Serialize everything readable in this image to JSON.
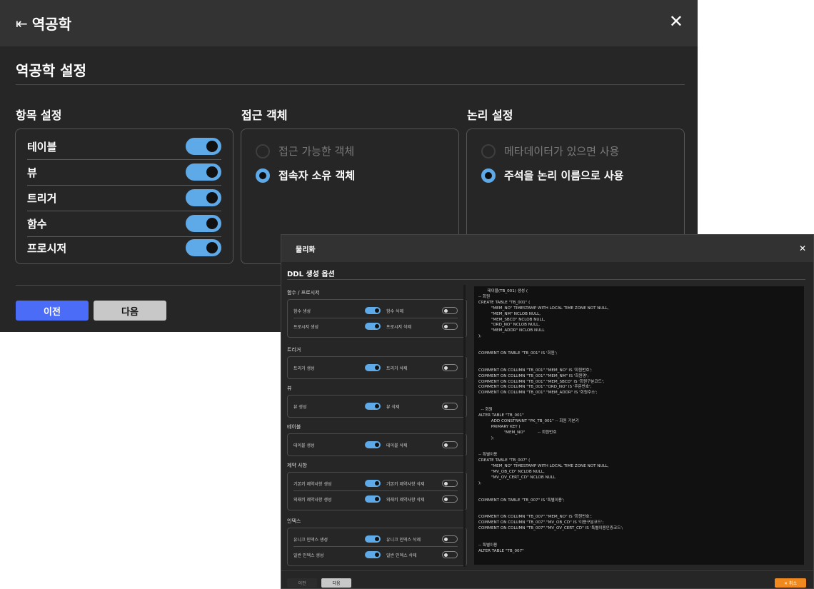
{
  "main": {
    "title": "역공학",
    "title_icon": "⇤",
    "close": "✕",
    "section_title": "역공학 설정",
    "columns": {
      "items": {
        "heading": "항목 설정",
        "rows": [
          "테이블",
          "뷰",
          "트리거",
          "함수",
          "프로시저"
        ]
      },
      "access": {
        "heading": "접근 객체",
        "options": [
          "접근 가능한 객체",
          "접속자 소유 객체"
        ]
      },
      "logic": {
        "heading": "논리 설정",
        "options": [
          "메타데이터가 있으면 사용",
          "주석을 논리 이름으로 사용"
        ]
      }
    },
    "buttons": {
      "prev": "이전",
      "next": "다음"
    },
    "colors": {
      "accent": "#5ea9e8",
      "primary_button": "#4a6cf7"
    }
  },
  "ddl": {
    "title": "물리화",
    "close": "✕",
    "section_title": "DDL 생성 옵션",
    "groups": [
      {
        "label": "함수 / 프로시저",
        "rows": [
          [
            "함수 생성",
            "함수 삭제"
          ],
          [
            "프로시저 생성",
            "프로시저 삭제"
          ]
        ]
      },
      {
        "label": "트리거",
        "rows": [
          [
            "트리거 생성",
            "트리거 삭제"
          ]
        ]
      },
      {
        "label": "뷰",
        "rows": [
          [
            "뷰 생성",
            "뷰 삭제"
          ]
        ]
      },
      {
        "label": "테이블",
        "rows": [
          [
            "테이블 생성",
            "테이블 삭제"
          ]
        ]
      },
      {
        "label": "제약 사항",
        "rows": [
          [
            "기본키 제약사항 생성",
            "기본키 제약사항 삭제"
          ],
          [
            "외래키 제약사항 생성",
            "외래키 제약사항 삭제"
          ]
        ]
      },
      {
        "label": "인덱스",
        "rows": [
          [
            "유니크 인덱스 생성",
            "유니크 인덱스 삭제"
          ],
          [
            "일반 인덱스 생성",
            "일반 인덱스 삭제"
          ]
        ]
      }
    ],
    "code": "       테이블(TB_001) 생성 (\n-- 회원\nCREATE TABLE \"TB_001\" (\n          \"MEM_NO\" TIMESTAMP WITH LOCAL TIME ZONE NOT NULL,\n          \"MEM_NM\" NCLOB NULL,\n          \"MEM_SBCD\" NCLOB NULL,\n          \"ORD_NO\" NCLOB NULL,\n          \"MEM_ADDR\" NCLOB NULL\n);\n\n\nCOMMENT ON TABLE \"TB_001\" IS '회원';\n\n\nCOMMENT ON COLUMN \"TB_001\".\"MEM_NO\" IS '회원번호';\nCOMMENT ON COLUMN \"TB_001\".\"MEM_NM\" IS '회원명';\nCOMMENT ON COLUMN \"TB_001\".\"MEM_SBCD\" IS '회원구분코드';\nCOMMENT ON COLUMN \"TB_001\".\"ORD_NO\" IS '주문번호';\nCOMMENT ON COLUMN \"TB_001\".\"MEM_ADDR\" IS '회원주소';\n\n\n  -- 회원\nALTER TABLE \"TB_001\"\n          ADD CONSTRAINT \"PK_TB_001\" -- 회원 기본키\n          PRIMARY KEY (\n                    \"MEM_NO\"          -- 회원번호\n          );\n\n\n-- 특별이용\nCREATE TABLE \"TB_007\" (\n          \"MEM_NO\" TIMESTAMP WITH LOCAL TIME ZONE NOT NULL,\n          \"MV_OB_CD\" NCLOB NULL,\n          \"MV_OV_CERT_CD\" NCLOB NULL\n);\n\n\nCOMMENT ON TABLE \"TB_007\" IS '특별이용';\n\n\nCOMMENT ON COLUMN \"TB_007\".\"MEM_NO\" IS '회원번호';\nCOMMENT ON COLUMN \"TB_007\".\"MV_OB_CD\" IS '이용구분코드';\nCOMMENT ON COLUMN \"TB_007\".\"MV_OV_CERT_CD\" IS '특별이용인증코드';\n\n\n-- 특별이용\nALTER TABLE \"TB_007\"",
    "buttons": {
      "prev": "이전",
      "next": "다음",
      "cancel": "✕ 취소"
    },
    "colors": {
      "cancel": "#f08a1e"
    }
  }
}
